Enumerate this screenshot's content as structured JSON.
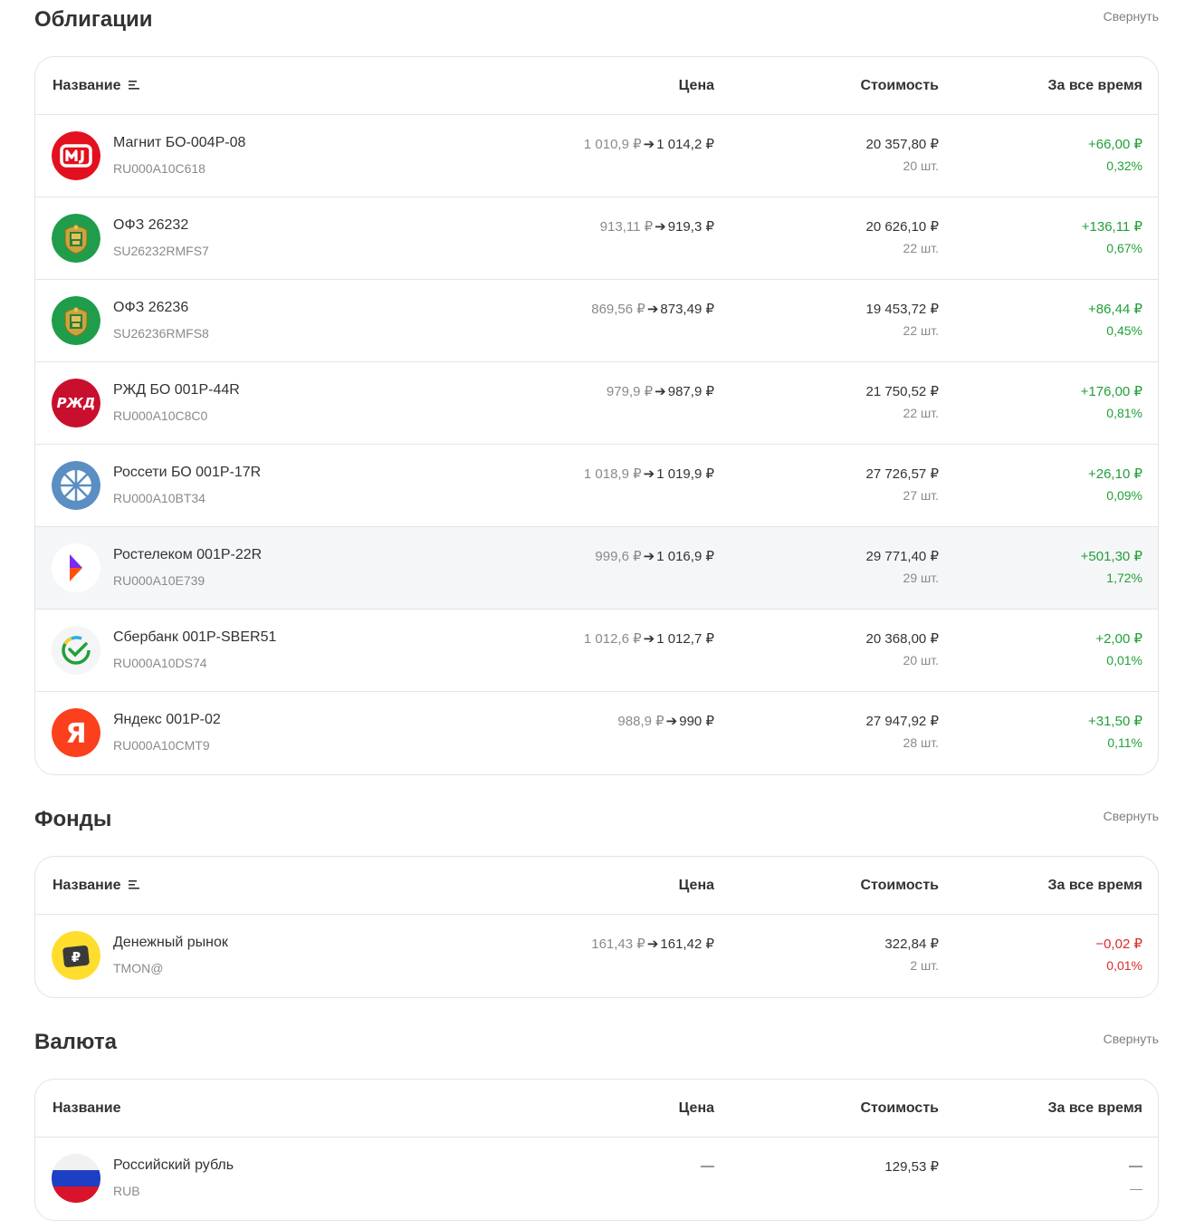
{
  "headers": {
    "name": "Название",
    "price": "Цена",
    "cost": "Стоимость",
    "total": "За все время"
  },
  "collapse_label": "Свернуть",
  "arrow": "➔",
  "colors": {
    "positive": "#21a038",
    "negative": "#db2b2b",
    "muted": "#8a8a8a"
  },
  "bonds": {
    "title": "Облигации",
    "rows": [
      {
        "logo": "magnit-logo",
        "name": "Магнит БО-004P-08",
        "ticker": "RU000A10C618",
        "price_old": "1 010,9 ₽",
        "price_new": "1 014,2 ₽",
        "cost": "20 357,80 ₽",
        "qty": "20 шт.",
        "pl": "+66,00 ₽",
        "plp": "0,32%"
      },
      {
        "logo": "ofz-emblem-logo",
        "name": "ОФЗ 26232",
        "ticker": "SU26232RMFS7",
        "price_old": "913,11 ₽",
        "price_new": "919,3 ₽",
        "cost": "20 626,10 ₽",
        "qty": "22 шт.",
        "pl": "+136,11 ₽",
        "plp": "0,67%"
      },
      {
        "logo": "ofz-emblem-logo",
        "name": "ОФЗ 26236",
        "ticker": "SU26236RMFS8",
        "price_old": "869,56 ₽",
        "price_new": "873,49 ₽",
        "cost": "19 453,72 ₽",
        "qty": "22 шт.",
        "pl": "+86,44 ₽",
        "plp": "0,45%"
      },
      {
        "logo": "rzd-logo",
        "name": "РЖД БО 001P-44R",
        "ticker": "RU000A10C8C0",
        "price_old": "979,9 ₽",
        "price_new": "987,9 ₽",
        "cost": "21 750,52 ₽",
        "qty": "22 шт.",
        "pl": "+176,00 ₽",
        "plp": "0,81%"
      },
      {
        "logo": "rosseti-logo",
        "name": "Россети БО 001P-17R",
        "ticker": "RU000A10BT34",
        "price_old": "1 018,9 ₽",
        "price_new": "1 019,9 ₽",
        "cost": "27 726,57 ₽",
        "qty": "27 шт.",
        "pl": "+26,10 ₽",
        "plp": "0,09%"
      },
      {
        "logo": "rostelecom-logo",
        "name": "Ростелеком 001P-22R",
        "ticker": "RU000A10E739",
        "price_old": "999,6 ₽",
        "price_new": "1 016,9 ₽",
        "cost": "29 771,40 ₽",
        "qty": "29 шт.",
        "pl": "+501,30 ₽",
        "plp": "1,72%"
      },
      {
        "logo": "sber-logo",
        "name": "Сбербанк 001P-SBER51",
        "ticker": "RU000A10DS74",
        "price_old": "1 012,6 ₽",
        "price_new": "1 012,7 ₽",
        "cost": "20 368,00 ₽",
        "qty": "20 шт.",
        "pl": "+2,00 ₽",
        "plp": "0,01%"
      },
      {
        "logo": "yandex-logo",
        "name": "Яндекс 001P-02",
        "ticker": "RU000A10CMT9",
        "price_old": "988,9 ₽",
        "price_new": "990 ₽",
        "cost": "27 947,92 ₽",
        "qty": "28 шт.",
        "pl": "+31,50 ₽",
        "plp": "0,11%"
      }
    ]
  },
  "funds": {
    "title": "Фонды",
    "rows": [
      {
        "logo": "money-market-logo",
        "name": "Денежный рынок",
        "ticker": "TMON@",
        "price_old": "161,43 ₽",
        "price_new": "161,42 ₽",
        "cost": "322,84 ₽",
        "qty": "2 шт.",
        "pl": "−0,02 ₽",
        "plp": "0,01%"
      }
    ]
  },
  "currency": {
    "title": "Валюта",
    "rows": [
      {
        "logo": "russia-flag-logo",
        "name": "Российский рубль",
        "ticker": "RUB",
        "price_dash": "—",
        "cost": "129,53 ₽",
        "pl_dash": "—",
        "plp_dash": "—"
      }
    ]
  }
}
